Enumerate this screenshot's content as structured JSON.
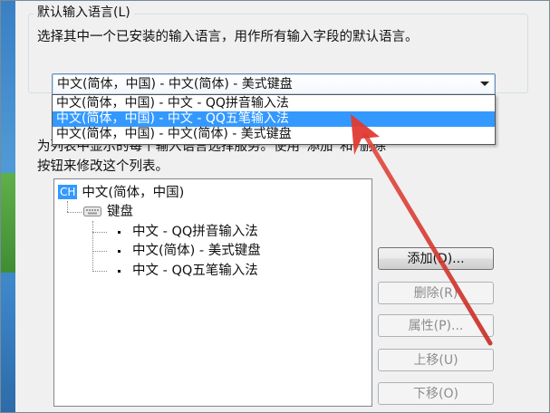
{
  "group": {
    "title": "默认输入语言(L)",
    "description": "选择其中一个已安装的输入语言，用作所有输入字段的默认语言。"
  },
  "combo": {
    "selected_value": "中文(简体，中国) - 中文(简体) - 美式键盘",
    "options": [
      "中文(简体，中国) - 中文 - QQ拼音输入法",
      "中文(简体，中国) - 中文 - QQ五笔输入法",
      "中文(简体，中国) - 中文(简体) - 美式键盘"
    ],
    "highlighted_index": 1
  },
  "services": {
    "description_line1": "为列表中显示的每个输入语言选择服务。使用“添加”和“删除”",
    "description_line2": "按钮来修改这个列表。"
  },
  "tree": {
    "root_badge": "CH",
    "root_label": "中文(简体，中国)",
    "keyboard_label": "键盘",
    "items": [
      "中文 - QQ拼音输入法",
      "中文(简体) - 美式键盘",
      "中文 - QQ五笔输入法"
    ]
  },
  "buttons": {
    "add": "添加(D)...",
    "remove": "删除(R)",
    "properties": "属性(P)...",
    "move_up": "上移(U)",
    "move_down": "下移(O)"
  },
  "colors": {
    "selection": "#3399ff",
    "annotation_arrow": "#e03a32"
  }
}
